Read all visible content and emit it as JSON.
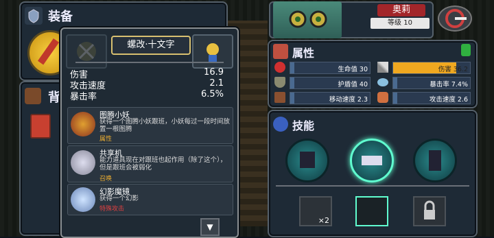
{
  "equipment": {
    "title": "装备"
  },
  "backpack": {
    "title": "背"
  },
  "item": {
    "name": "螺改·十文字",
    "stats": [
      {
        "label": "伤害",
        "value": "16.9"
      },
      {
        "label": "攻击速度",
        "value": "2.1"
      },
      {
        "label": "暴击率",
        "value": "6.5%"
      }
    ],
    "perks": [
      {
        "title": "图腾小妖",
        "desc": "获得一个图腾小妖跟班，小妖每过一段时间放置一根图腾",
        "kind": "属性",
        "kind_color": "#f0b030"
      },
      {
        "title": "共享机",
        "desc": "能力道具现在对跟班也起作用（除了这个），但是跟班会被弱化",
        "kind": "召唤",
        "kind_color": "#f0b030"
      },
      {
        "title": "幻影魔镜",
        "desc": "获得一个幻影",
        "kind": "特殊攻击",
        "kind_color": "#e04040"
      }
    ]
  },
  "character": {
    "name": "奥莉",
    "level_text": "等级 10"
  },
  "attributes": {
    "title": "属性",
    "rows": [
      {
        "label": "生命值 30",
        "fill": 0.05
      },
      {
        "label": "伤害 36.2",
        "fill": 0.82,
        "color": "#f0a820"
      },
      {
        "label": "护盾值 40",
        "fill": 0.05
      },
      {
        "label": "暴击率 7.4%",
        "fill": 0.05
      },
      {
        "label": "移动速度 2.3",
        "fill": 0.05
      },
      {
        "label": "攻击速度 2.6",
        "fill": 0.05
      }
    ]
  },
  "skills": {
    "title": "技能",
    "multiplier": "×2"
  },
  "colors": {
    "panel_bg": "#1e2a36",
    "panel_border": "#55606a",
    "accent_gold": "#d8c070",
    "name_red": "#a2262a"
  }
}
